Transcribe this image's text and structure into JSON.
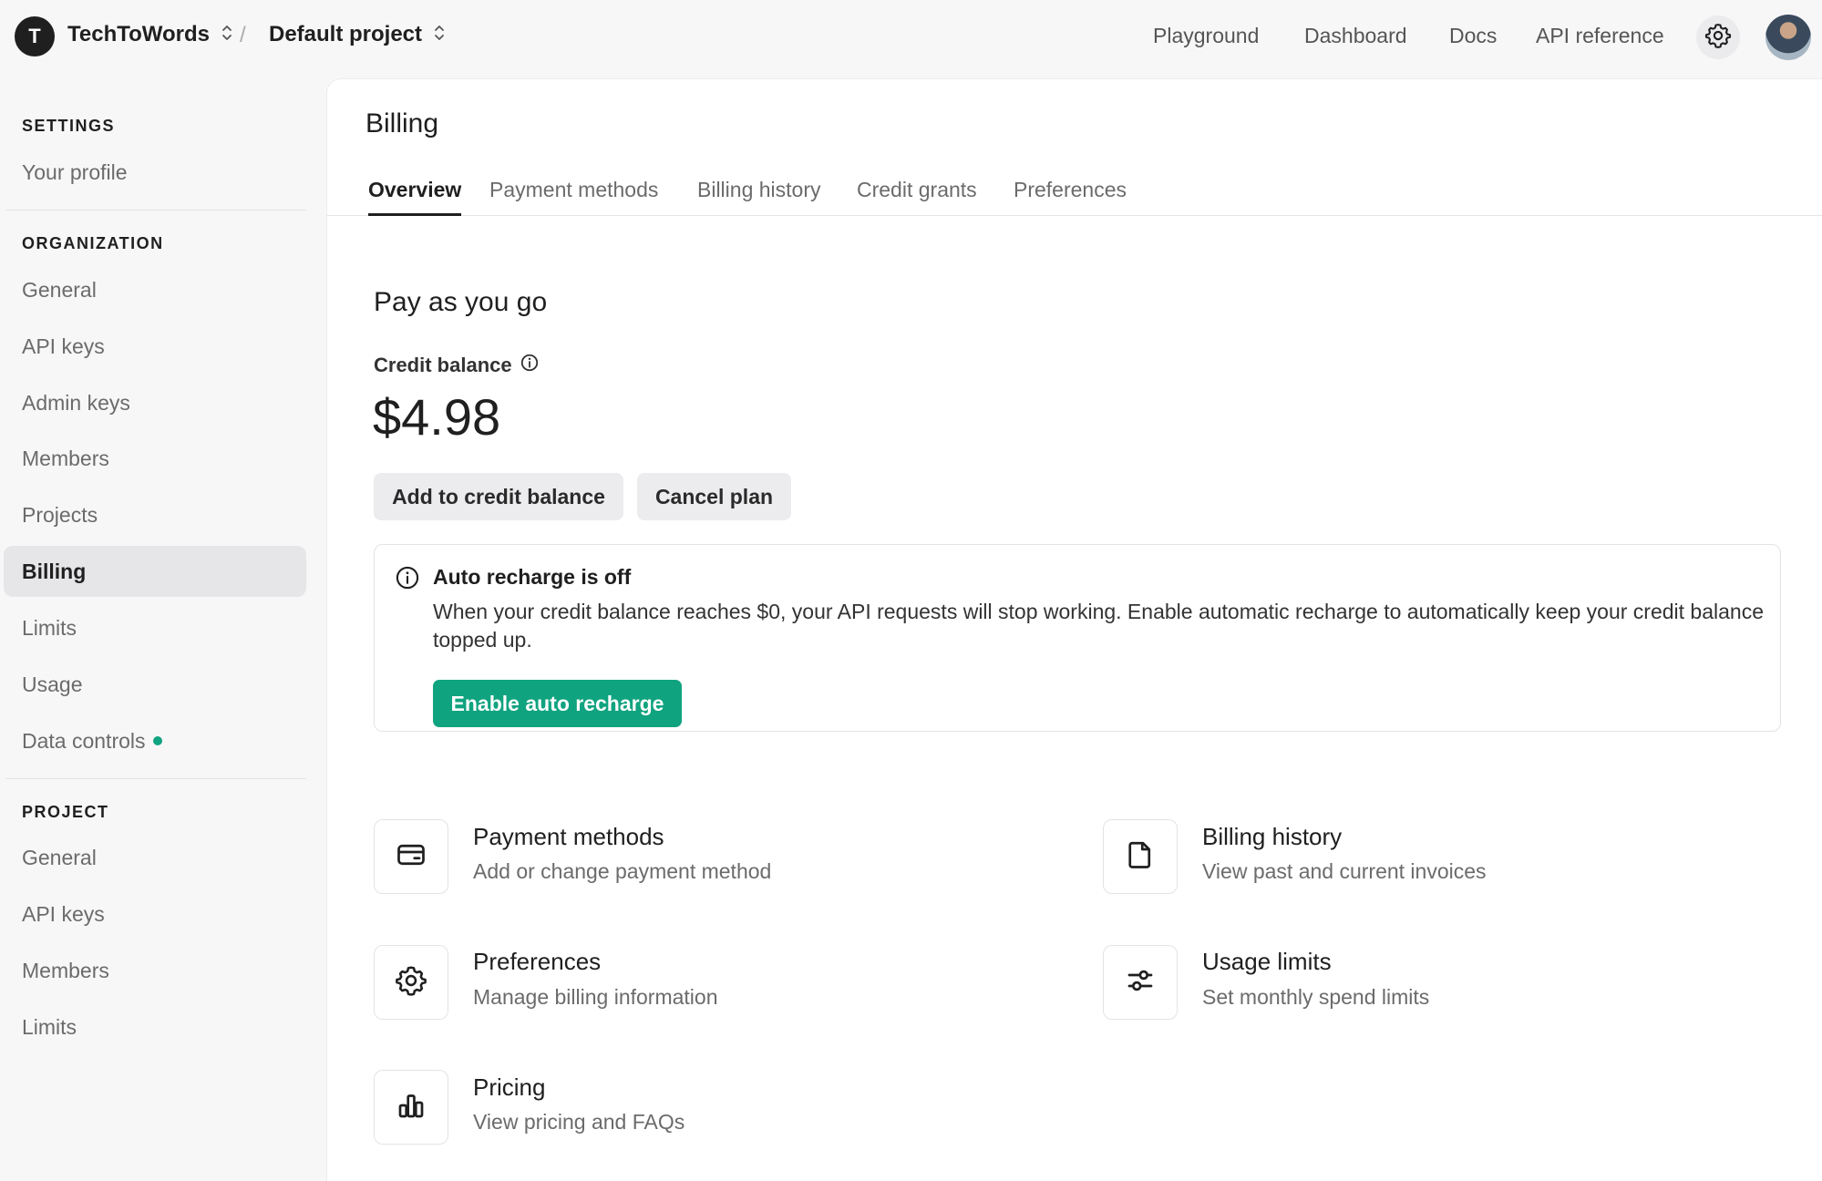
{
  "topbar": {
    "org_initial": "T",
    "org_name": "TechToWords",
    "separator": "/",
    "project_name": "Default project",
    "nav": [
      "Playground",
      "Dashboard",
      "Docs",
      "API reference"
    ]
  },
  "sidebar": {
    "settings_heading": "SETTINGS",
    "your_profile": "Your profile",
    "organization_heading": "ORGANIZATION",
    "org_items": [
      "General",
      "API keys",
      "Admin keys",
      "Members",
      "Projects",
      "Billing",
      "Limits",
      "Usage",
      "Data controls"
    ],
    "project_heading": "PROJECT",
    "project_items": [
      "General",
      "API keys",
      "Members",
      "Limits"
    ]
  },
  "main": {
    "title": "Billing",
    "tabs": [
      "Overview",
      "Payment methods",
      "Billing history",
      "Credit grants",
      "Preferences"
    ],
    "section_title": "Pay as you go",
    "balance_label": "Credit balance",
    "balance_value": "$4.98",
    "add_credit_label": "Add to credit balance",
    "cancel_plan_label": "Cancel plan",
    "notice": {
      "title": "Auto recharge is off",
      "text": "When your credit balance reaches $0, your API requests will stop working. Enable automatic recharge to automatically keep your credit balance topped up.",
      "button": "Enable auto recharge"
    },
    "cards": [
      {
        "title": "Payment methods",
        "desc": "Add or change payment method",
        "icon": "credit-card-icon"
      },
      {
        "title": "Billing history",
        "desc": "View past and current invoices",
        "icon": "document-icon"
      },
      {
        "title": "Preferences",
        "desc": "Manage billing information",
        "icon": "gear-icon"
      },
      {
        "title": "Usage limits",
        "desc": "Set monthly spend limits",
        "icon": "sliders-icon"
      },
      {
        "title": "Pricing",
        "desc": "View pricing and FAQs",
        "icon": "bar-chart-icon"
      }
    ]
  },
  "colors": {
    "accent_green": "#10a37f",
    "active_bg": "#e6e6e9",
    "page_bg": "#f7f7f8"
  }
}
